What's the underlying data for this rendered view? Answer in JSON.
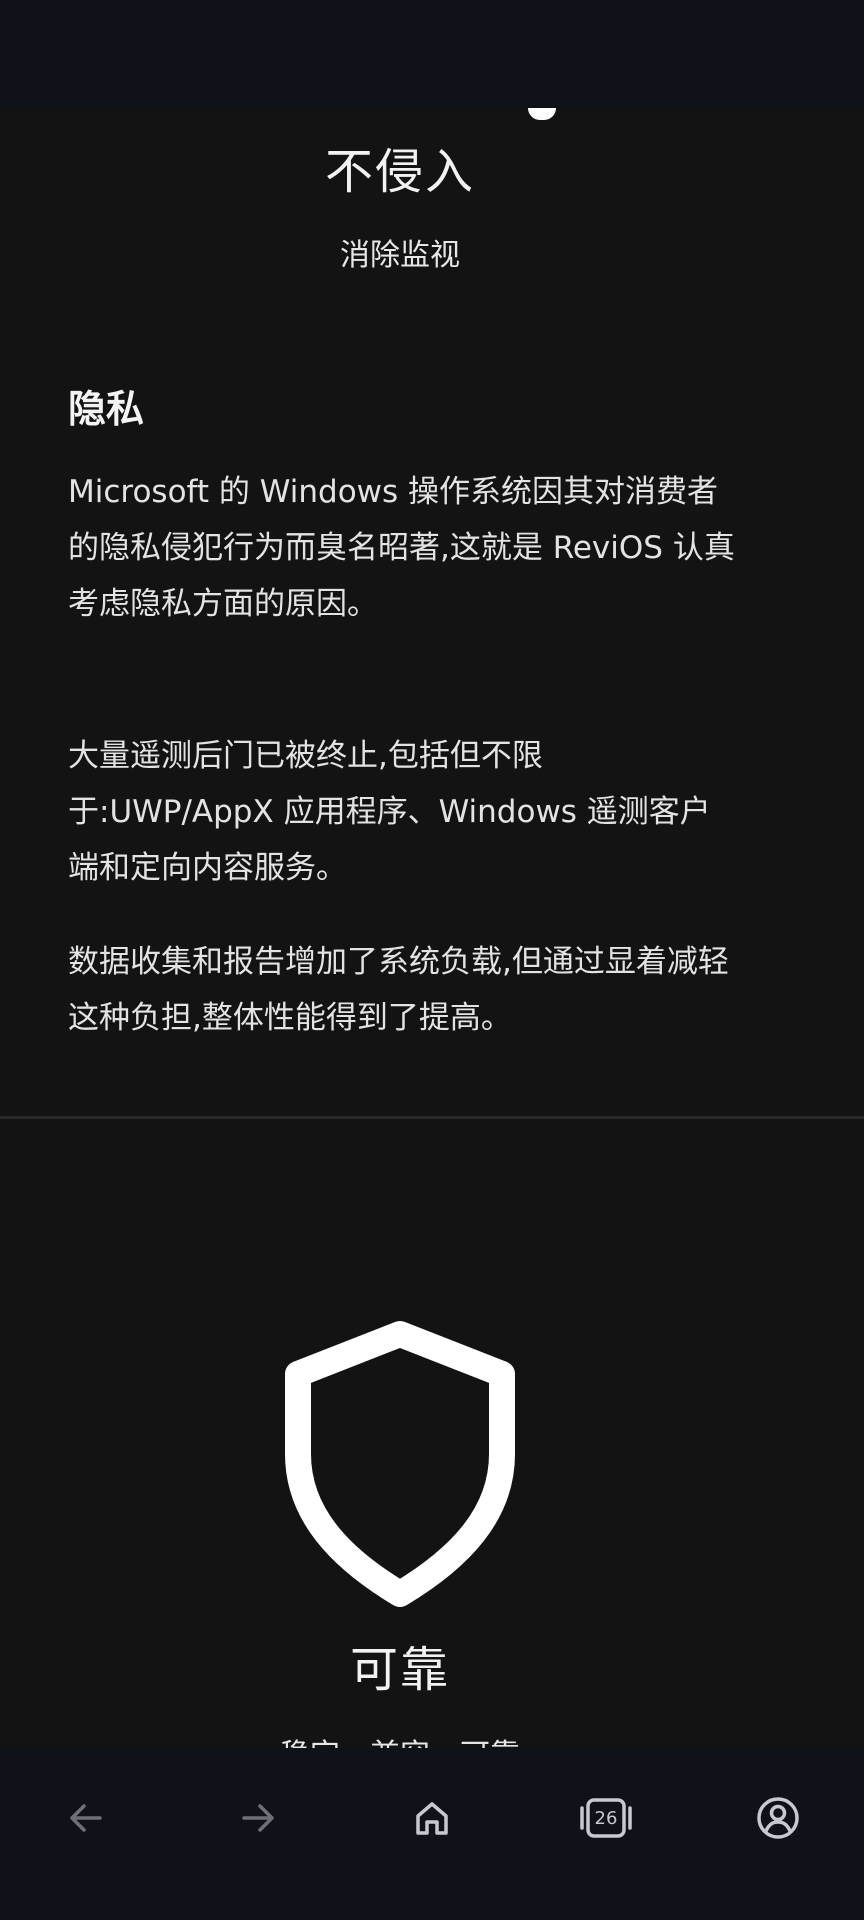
{
  "hero": {
    "title": "不侵入",
    "subtitle": "消除监视"
  },
  "privacy": {
    "heading": "隐私",
    "paragraphs": [
      "Microsoft 的 Windows 操作系统因其对消费者的隐私侵犯行为而臭名昭著,这就是 ReviOS 认真考虑隐私方面的原因。",
      "大量遥测后门已被终止,包括但不限于:UWP/AppX 应用程序、Windows 遥测客户端和定向内容服务。",
      "数据收集和报告增加了系统负载,但通过显着减轻这种负担,整体性能得到了提高。"
    ]
  },
  "reliable": {
    "icon": "shield-icon",
    "title": "可靠",
    "subtitle": "稳定、兼容、可靠"
  },
  "bottom_nav": {
    "items": [
      {
        "icon": "back-arrow-icon"
      },
      {
        "icon": "forward-arrow-icon"
      },
      {
        "icon": "home-icon"
      },
      {
        "icon": "tabs-icon",
        "count": "26"
      },
      {
        "icon": "account-icon"
      }
    ]
  },
  "colors": {
    "background": "#131314",
    "bars": "#10121a",
    "text": "#e9e9ea",
    "nav_icon": "#c7c9d1",
    "nav_icon_disabled": "#6e7078"
  }
}
